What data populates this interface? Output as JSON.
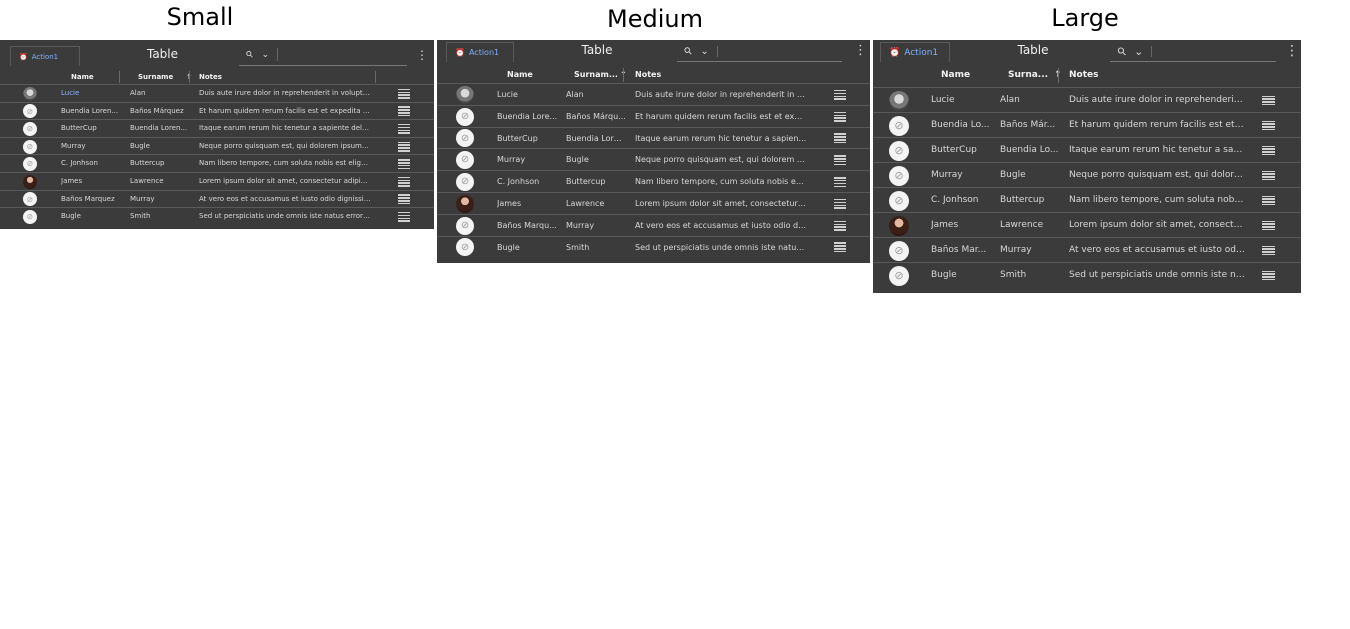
{
  "sections": [
    {
      "key": "small",
      "label": "Small"
    },
    {
      "key": "medium",
      "label": "Medium"
    },
    {
      "key": "large",
      "label": "Large"
    }
  ],
  "toolbar": {
    "action_label": "Action1",
    "title": "Table",
    "search_icon": "search-icon",
    "dropdown_icon": "chevron-down-icon",
    "more_icon": "kebab-menu-icon"
  },
  "columns": {
    "name": "Name",
    "surname": "Surname",
    "notes": "Notes"
  },
  "columns_truncated": {
    "medium_surname": "Surnam...",
    "large_surname": "Surna..."
  },
  "sort_indicator": "↑",
  "rows": [
    {
      "name": "Lucie",
      "surname": "Alan",
      "notes": "Duis aute irure dolor in reprehenderit in voluptat...",
      "avatar": "photo-male"
    },
    {
      "name": "Buendia Loren...",
      "surname": "Baños Márquez",
      "notes": "Et harum quidem rerum facilis est et expedita dis...",
      "avatar": "placeholder"
    },
    {
      "name": "ButterCup",
      "surname": "Buendia Loren...",
      "notes": "Itaque earum rerum hic tenetur a sapiente delec...",
      "avatar": "placeholder"
    },
    {
      "name": "Murray",
      "surname": "Bugle",
      "notes": "Neque porro quisquam est, qui dolorem ipsum q...",
      "avatar": "placeholder"
    },
    {
      "name": "C. Jonhson",
      "surname": "Buttercup",
      "notes": "Nam libero tempore, cum soluta nobis est eligen...",
      "avatar": "placeholder"
    },
    {
      "name": "James",
      "surname": "Lawrence",
      "notes": "Lorem ipsum dolor sit amet, consectetur adipisci...",
      "avatar": "photo-female"
    },
    {
      "name": "Baños Marquez",
      "surname": "Murray",
      "notes": "At vero eos et accusamus et iusto odio dignissim...",
      "avatar": "placeholder"
    },
    {
      "name": "Bugle",
      "surname": "Smith",
      "notes": "Sed ut perspiciatis unde omnis iste natus error si...",
      "avatar": "placeholder"
    }
  ],
  "rows_medium": [
    {
      "name": "Lucie",
      "surname": "Alan",
      "notes": "Duis aute irure dolor in reprehenderit in volu..."
    },
    {
      "name": "Buendia Lore...",
      "surname": "Baños Márqu...",
      "notes": "Et harum quidem rerum facilis est et expedit..."
    },
    {
      "name": "ButterCup",
      "surname": "Buendia Lore...",
      "notes": "Itaque earum rerum hic tenetur a sapiente d..."
    },
    {
      "name": "Murray",
      "surname": "Bugle",
      "notes": "Neque porro quisquam est, qui dolorem ipsu..."
    },
    {
      "name": "C. Jonhson",
      "surname": "Buttercup",
      "notes": "Nam libero tempore, cum soluta nobis est eli..."
    },
    {
      "name": "James",
      "surname": "Lawrence",
      "notes": "Lorem ipsum dolor sit amet, consectetur adi..."
    },
    {
      "name": "Baños Marqu...",
      "surname": "Murray",
      "notes": "At vero eos et accusamus et iusto odio digni..."
    },
    {
      "name": "Bugle",
      "surname": "Smith",
      "notes": "Sed ut perspiciatis unde omnis iste natus err..."
    }
  ],
  "rows_large": [
    {
      "name": "Lucie",
      "surname": "Alan",
      "notes": "Duis aute irure dolor in reprehenderit i..."
    },
    {
      "name": "Buendia Lo...",
      "surname": "Baños Már...",
      "notes": "Et harum quidem rerum facilis est et e..."
    },
    {
      "name": "ButterCup",
      "surname": "Buendia Lo...",
      "notes": "Itaque earum rerum hic tenetur a sapi..."
    },
    {
      "name": "Murray",
      "surname": "Bugle",
      "notes": "Neque porro quisquam est, qui dolore..."
    },
    {
      "name": "C. Jonhson",
      "surname": "Buttercup",
      "notes": "Nam libero tempore, cum soluta nobi..."
    },
    {
      "name": "James",
      "surname": "Lawrence",
      "notes": "Lorem ipsum dolor sit amet, consectet..."
    },
    {
      "name": "Baños Mar...",
      "surname": "Murray",
      "notes": "At vero eos et accusamus et iusto odi..."
    },
    {
      "name": "Bugle",
      "surname": "Smith",
      "notes": "Sed ut perspiciatis unde omnis iste na..."
    }
  ],
  "colors": {
    "panel_bg": "#3b3b3b",
    "accent": "#7fb0ff",
    "text": "#d8d8d8"
  }
}
